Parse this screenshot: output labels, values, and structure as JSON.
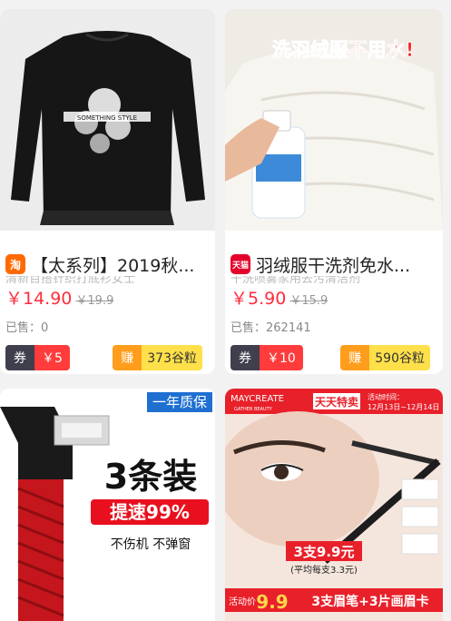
{
  "products": [
    {
      "tag": "淘",
      "tag_color": "#ff6a00",
      "title": "【太系列】2019秋...",
      "price": "￥14.90",
      "original_price": "￥19.9",
      "sold": "已售：0",
      "coupon_label": "券",
      "coupon_value": "￥5",
      "earn_label": "赚",
      "earn_value": "373谷粒",
      "image_text": "SOMETHING STYLE"
    },
    {
      "tag": "天猫",
      "tag_color": "#e4002b",
      "title": "羽绒服干洗剂免水...",
      "price": "￥5.90",
      "original_price": "￥15.9",
      "sold": "已售：262141",
      "coupon_label": "券",
      "coupon_value": "￥10",
      "earn_label": "赚",
      "earn_value": "590谷粒",
      "image_text": "洗羽绒服不用水!"
    },
    {
      "badge": "一年质保",
      "headline": "3条装",
      "speed": "提速99%",
      "sub": "不伤机  不弹窗"
    },
    {
      "brand": "MAYCREATE",
      "brand_sub": "GATHER BEAUTY",
      "promo": "天天特卖",
      "period_label": "活动时间：",
      "period": "12月13日~12月14日",
      "deal": "3支9.9元",
      "deal_sub": "(平均每支3.3元)",
      "price_label": "活动价",
      "price": "9.9",
      "footer": "3支眉笔+3片画眉卡"
    }
  ]
}
